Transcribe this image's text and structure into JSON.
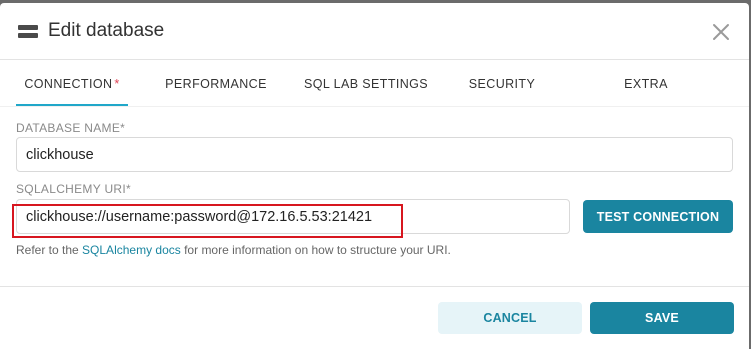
{
  "modal": {
    "title": "Edit database",
    "icon": "database-icon",
    "close_icon": "close-icon"
  },
  "tabs": [
    {
      "label": "CONNECTION",
      "required_mark": "*",
      "active": true
    },
    {
      "label": "PERFORMANCE",
      "active": false
    },
    {
      "label": "SQL LAB SETTINGS",
      "active": false
    },
    {
      "label": "SECURITY",
      "active": false
    },
    {
      "label": "EXTRA",
      "active": false
    }
  ],
  "fields": {
    "database_name": {
      "label": "DATABASE NAME*",
      "value": "clickhouse"
    },
    "sqlalchemy_uri": {
      "label": "SQLALCHEMY URI*",
      "value": "clickhouse://username:password@172.16.5.53:21421"
    }
  },
  "buttons": {
    "test_connection": "TEST CONNECTION",
    "cancel": "CANCEL",
    "save": "SAVE"
  },
  "helper": {
    "prefix": "Refer to the ",
    "link": "SQLAlchemy docs",
    "suffix": " for more information on how to structure your URI."
  },
  "colors": {
    "accent": "#1a85a0",
    "tab_underline": "#20a7c9",
    "required": "#e04355",
    "highlight_border": "#d7161f"
  }
}
